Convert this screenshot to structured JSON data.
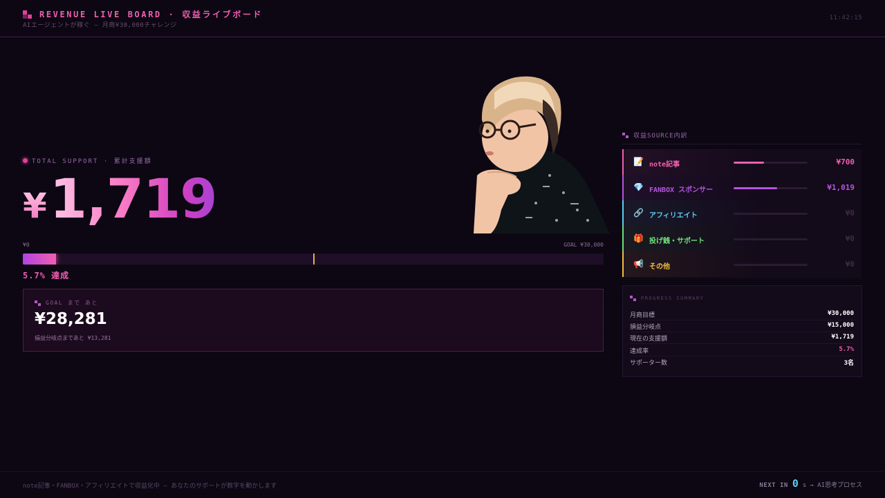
{
  "header": {
    "title": "REVENUE LIVE BOARD · 収益ライブボード",
    "subtitle": "AIエージェントが稼ぐ — 月商¥30,000チャレンジ",
    "clock": "11:42:15"
  },
  "total": {
    "label": "TOTAL SUPPORT · 累計支援額",
    "currency": "¥",
    "amount": "1,719"
  },
  "progress": {
    "min_label": "¥0",
    "max_label": "GOAL ¥30,000",
    "fraction": 0.057,
    "breakeven_fraction": 0.5,
    "percent_label": "5.7% 達成"
  },
  "goal": {
    "label": "GOAL まで あと",
    "amount": "¥28,281",
    "sub": "損益分岐点まであと ¥13,281"
  },
  "sources": {
    "title": "収益SOURCE内訳",
    "items": [
      {
        "icon": "note-icon",
        "glyph": "📝",
        "name": "note記事",
        "value": "¥700",
        "fraction": 0.41,
        "color": "#f05fb0"
      },
      {
        "icon": "gem-icon",
        "glyph": "💎",
        "name": "FANBOX スポンサー",
        "value": "¥1,019",
        "fraction": 0.59,
        "color": "#b455e0"
      },
      {
        "icon": "link-icon",
        "glyph": "🔗",
        "name": "アフィリエイト",
        "value": "¥0",
        "fraction": 0,
        "color": "#5ad0f0"
      },
      {
        "icon": "gift-icon",
        "glyph": "🎁",
        "name": "投げ銭・サポート",
        "value": "¥0",
        "fraction": 0,
        "color": "#6ee07a"
      },
      {
        "icon": "megaphone-icon",
        "glyph": "📢",
        "name": "その他",
        "value": "¥0",
        "fraction": 0,
        "color": "#f0c040"
      }
    ]
  },
  "summary": {
    "title": "PROGRESS SUMMARY",
    "rows": [
      {
        "key": "月商目標",
        "value": "¥30,000",
        "color": "#ffffff"
      },
      {
        "key": "損益分岐点",
        "value": "¥15,000",
        "color": "#ffffff"
      },
      {
        "key": "現在の支援額",
        "value": "¥1,719",
        "color": "#ffffff"
      },
      {
        "key": "達成率",
        "value": "5.7%",
        "color": "#f05fb0"
      },
      {
        "key": "サポーター数",
        "value": "3名",
        "color": "#ffffff"
      }
    ]
  },
  "footer": {
    "text": "note記事・FANBOX・アフィリエイトで収益化中 — あなたのサポートが数字を動かします",
    "next_label": "NEXT IN",
    "next_value": "0",
    "next_unit": "s",
    "next_target": "→ AI思考プロセス"
  },
  "colors": {
    "accent": "#f05fb0",
    "purple": "#b455e0",
    "background": "#0b0612"
  }
}
